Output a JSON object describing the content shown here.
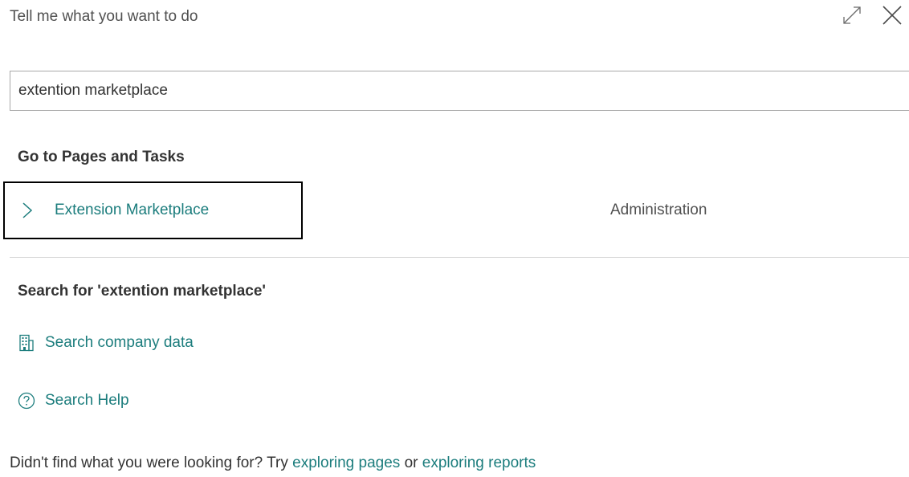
{
  "dialog": {
    "title": "Tell me what you want to do"
  },
  "search": {
    "value": "extention marketplace"
  },
  "pages_section": {
    "heading": "Go to Pages and Tasks",
    "results": [
      {
        "label": "Extension Marketplace",
        "category": "Administration"
      }
    ]
  },
  "search_section": {
    "heading": "Search for 'extention marketplace'",
    "actions": [
      {
        "label": "Search company data",
        "icon": "building-icon"
      },
      {
        "label": "Search Help",
        "icon": "help-circle-icon"
      }
    ]
  },
  "footer": {
    "prefix": "Didn't find what you were looking for? Try ",
    "link1": "exploring pages",
    "middle": " or ",
    "link2": "exploring reports"
  },
  "colors": {
    "accent": "#1c7d7d",
    "text": "#333333",
    "focus_border": "#000000"
  }
}
